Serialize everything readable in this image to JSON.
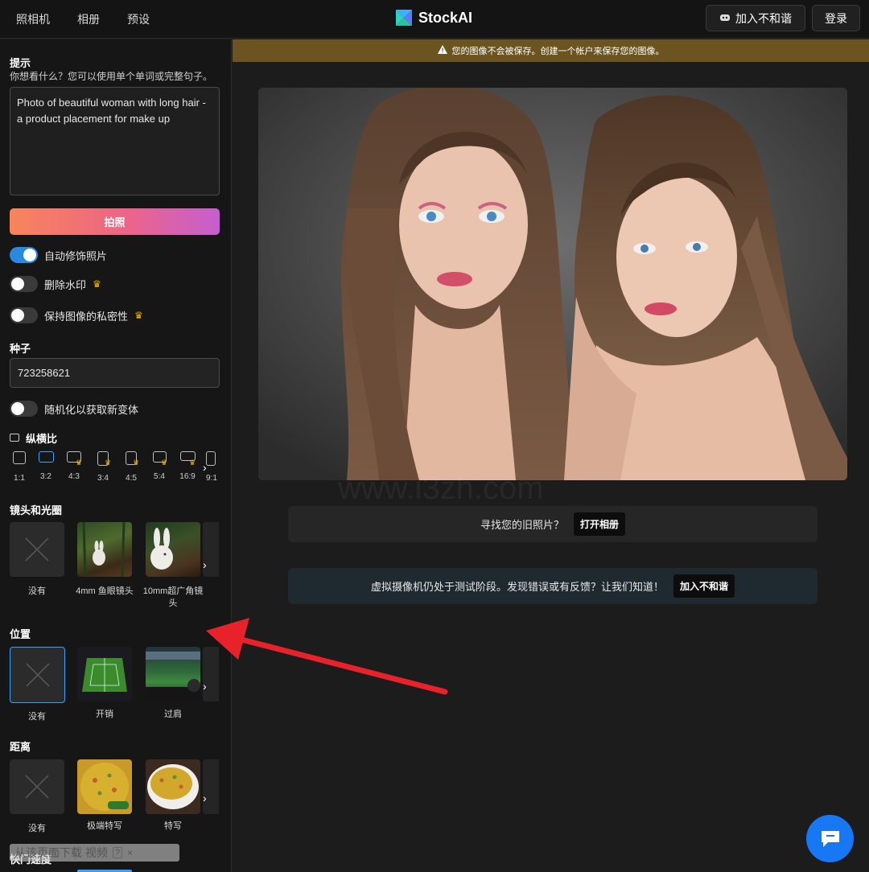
{
  "topbar": {
    "nav": [
      "照相机",
      "相册",
      "预设"
    ],
    "brand": "StockAI",
    "discord_label": "加入不和谐",
    "login_label": "登录"
  },
  "banner": {
    "text": "您的图像不会被保存。创建一个帐户来保存您的图像。"
  },
  "sidebar": {
    "prompt_title": "提示",
    "prompt_hint": "你想看什么？您可以使用单个单词或完整句子。",
    "prompt_value": "Photo of beautiful woman with long hair - a product placement for make up",
    "shoot_label": "拍照",
    "toggles": [
      {
        "label": "自动修饰照片",
        "on": true,
        "premium": false
      },
      {
        "label": "删除水印",
        "on": false,
        "premium": true
      },
      {
        "label": "保持图像的私密性",
        "on": false,
        "premium": true
      }
    ],
    "seed_title": "种子",
    "seed_value": "723258621",
    "randomize_label": "随机化以获取新变体",
    "ratio_title": "纵横比",
    "ratios": [
      "1:1",
      "3:2",
      "4:3",
      "3:4",
      "4:5",
      "5:4",
      "16:9",
      "9:1"
    ],
    "selected_ratio": "3:2",
    "lens_title": "镜头和光圈",
    "lens_items": [
      "没有",
      "4mm 鱼眼镜头",
      "10mm超广角镜头"
    ],
    "location_title": "位置",
    "location_items": [
      "没有",
      "开销",
      "过肩"
    ],
    "distance_title": "距离",
    "distance_items": [
      "没有",
      "极端特写",
      "特写"
    ],
    "shutter_title": "快门速度"
  },
  "main": {
    "old_photos_text": "寻找您的旧照片？",
    "open_album_label": "打开相册",
    "beta_text": "虚拟摄像机仍处于测试阶段。发现错误或有反馈？让我们知道！",
    "beta_discord_label": "加入不和谐"
  },
  "overlay": {
    "download_text": "从该页面下载 视频"
  },
  "colors": {
    "accent": "#2a8ae0",
    "banner": "#6b5420",
    "crown": "#f0b400"
  }
}
